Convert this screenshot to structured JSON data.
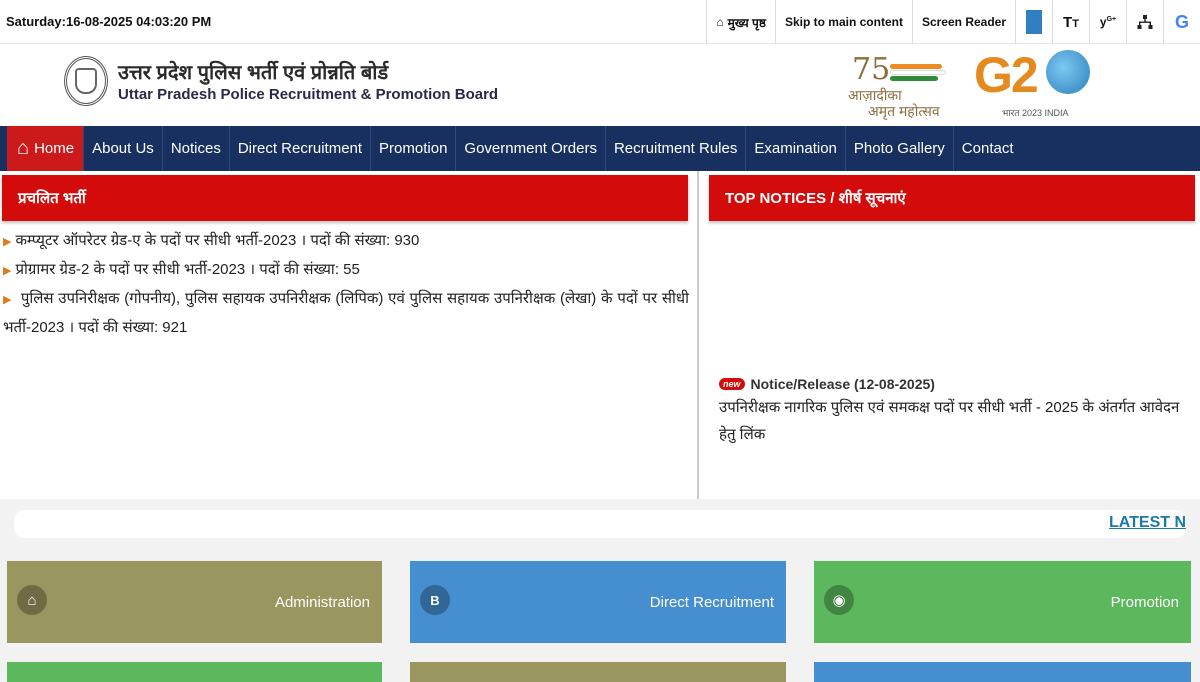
{
  "topbar": {
    "datetime": "Saturday:16-08-2025 04:03:20 PM",
    "links": {
      "home": "मुख्य पृष्ठ",
      "skip": "Skip to main content",
      "reader": "Screen Reader"
    },
    "icons": [
      "color-contrast-icon",
      "text-size-icon",
      "social-media-icon",
      "sitemap-icon",
      "google-translate-icon"
    ]
  },
  "header": {
    "title_hi": "उत्तर प्रदेश पुलिस भर्ती एवं प्रोन्नति बोर्ड",
    "title_en": "Uttar Pradesh Police Recruitment & Promotion Board",
    "azadi_num": "75",
    "azadi_line1": "आज़ादीका",
    "azadi_line2": "अमृत महोत्सव",
    "g20_text": "G2",
    "g20_sub": "भारत 2023 INDIA"
  },
  "nav": {
    "items": [
      "Home",
      "About Us",
      "Notices",
      "Direct Recruitment",
      "Promotion",
      "Government Orders",
      "Recruitment Rules",
      "Examination",
      "Photo Gallery",
      "Contact"
    ]
  },
  "left_panel": {
    "title": "प्रचलित भर्ती",
    "items": [
      "कम्प्यूटर ऑपरेटर ग्रेड-ए के पदों पर सीधी भर्ती-2023 । पदों की संख्या: 930",
      "प्रोग्रामर ग्रेड-2 के पदों पर सीधी भर्ती-2023 । पदों की संख्या: 55",
      "पुलिस उपनिरीक्षक (गोपनीय), पुलिस सहायक उपनिरीक्षक (लिपिक) एवं पुलिस सहायक उपनिरीक्षक (लेखा) के पदों पर सीधी भर्ती-2023 । पदों की संख्या: 921"
    ]
  },
  "right_panel": {
    "title": "TOP NOTICES / शीर्ष सूचनाएं",
    "new_badge": "new",
    "notice_title": "Notice/Release (12-08-2025)",
    "notice_text": "उपनिरीक्षक नागरिक पुलिस एवं समकक्ष पदों पर सीधी भर्ती - 2025 के अंतर्गत आवेदन हेतु लिंक"
  },
  "ticker": {
    "text": "LATEST NC"
  },
  "tiles": [
    {
      "label": "Administration",
      "color": "#9a9660"
    },
    {
      "label": "Direct Recruitment",
      "color": "#458fd1"
    },
    {
      "label": "Promotion",
      "color": "#5cb85c"
    }
  ],
  "colors": {
    "nav_bg": "#17305f",
    "accent_red": "#d40b0b",
    "link_blue": "#1a7aa6"
  }
}
